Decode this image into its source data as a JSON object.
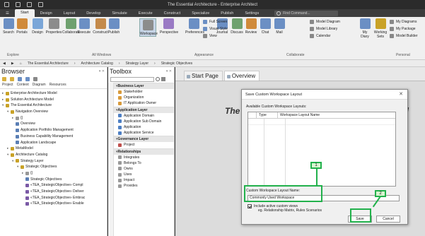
{
  "window": {
    "title": "The Essential Architecture - Enterprise Architect"
  },
  "ribbon_tabs": [
    "Start",
    "Design",
    "Layout",
    "Develop",
    "Simulate",
    "Execute",
    "Construct",
    "Specialize",
    "Publish",
    "Settings"
  ],
  "command_search": "Find Command...",
  "ribbon": {
    "buttons": [
      {
        "label": "Search",
        "icon": "search-icon"
      },
      {
        "label": "Portals",
        "icon": "portals-icon"
      },
      {
        "label": "Design",
        "icon": "design-icon"
      },
      {
        "label": "Properties",
        "icon": "properties-icon"
      },
      {
        "label": "Collaborate",
        "icon": "collaborate-icon"
      },
      {
        "label": "Execute",
        "icon": "execute-icon"
      },
      {
        "label": "Construct",
        "icon": "construct-icon"
      },
      {
        "label": "Publish",
        "icon": "publish-icon"
      },
      {
        "label": "Workspace",
        "icon": "workspace-icon"
      },
      {
        "label": "Perspective",
        "icon": "perspective-icon"
      },
      {
        "label": "Preferences",
        "icon": "preferences-icon"
      },
      {
        "label": "Journal",
        "icon": "journal-icon"
      },
      {
        "label": "Discuss",
        "icon": "discuss-icon"
      },
      {
        "label": "Review",
        "icon": "review-icon"
      },
      {
        "label": "Chat",
        "icon": "chat-icon"
      },
      {
        "label": "Mail",
        "icon": "mail-icon"
      },
      {
        "label": "My Diary",
        "icon": "diary-icon"
      },
      {
        "label": "Working Sets",
        "icon": "working-sets-icon"
      }
    ],
    "small": {
      "full_screen": "Full Screen",
      "visual_style": "Visual Style",
      "view": "View",
      "model_diagram": "Model Diagram",
      "model_library": "Model Library",
      "calendar": "Calendar",
      "my_diagrams": "My Diagrams",
      "my_package": "My Package",
      "model_builder": "Model Builder"
    },
    "groups": {
      "explore": "Explore",
      "all_windows": "All Windows",
      "appearance": "Appearance",
      "collaborate": "Collaborate",
      "personal": "Personal"
    }
  },
  "breadcrumb": [
    "The Essential Architecture",
    "Architecture Catalog",
    "Strategy Layer",
    "Strategic Objectives"
  ],
  "browser": {
    "title": "Browser",
    "tabs": [
      "Project",
      "Context",
      "Diagram",
      "Resources"
    ],
    "items": [
      {
        "label": "Enterprise Architecture Model",
        "exp": "▸",
        "indent": 0,
        "color": "#c9a227"
      },
      {
        "label": "Solution Architecture Model",
        "exp": "▸",
        "indent": 0,
        "color": "#c9a227"
      },
      {
        "label": "The Essential Architecture",
        "exp": "▾",
        "indent": 0,
        "color": "#c9a227"
      },
      {
        "label": "Navigation Overview",
        "exp": "▾",
        "indent": 1,
        "color": "#c9a227"
      },
      {
        "label": "{}",
        "exp": "▸",
        "indent": 2,
        "color": "#999"
      },
      {
        "label": "Overview",
        "exp": "",
        "indent": 2,
        "color": "#5b7fb5"
      },
      {
        "label": "Application Portfolio Management",
        "exp": "",
        "indent": 2,
        "color": "#5b7fb5"
      },
      {
        "label": "Business Capability Management",
        "exp": "",
        "indent": 2,
        "color": "#5b7fb5"
      },
      {
        "label": "Application Landscape",
        "exp": "",
        "indent": 2,
        "color": "#5b7fb5"
      },
      {
        "label": "MetaModel",
        "exp": "▸",
        "indent": 1,
        "color": "#c9a227"
      },
      {
        "label": "Architecture Catalog",
        "exp": "▾",
        "indent": 1,
        "color": "#c9a227"
      },
      {
        "label": "Strategy Layer",
        "exp": "▾",
        "indent": 2,
        "color": "#c9a227"
      },
      {
        "label": "Strategic Objectives",
        "exp": "▾",
        "indent": 3,
        "color": "#c9a227"
      },
      {
        "label": "{}",
        "exp": "▸",
        "indent": 4,
        "color": "#999"
      },
      {
        "label": "Strategic Objectives",
        "exp": "",
        "indent": 4,
        "color": "#5b7fb5"
      },
      {
        "label": "«TEA_StrategicObjective» Compl",
        "exp": "",
        "indent": 4,
        "color": "#7b5aa6"
      },
      {
        "label": "«TEA_StrategicObjective» Deliver",
        "exp": "",
        "indent": 4,
        "color": "#7b5aa6"
      },
      {
        "label": "«TEA_StrategicObjective» Embrac",
        "exp": "",
        "indent": 4,
        "color": "#7b5aa6"
      },
      {
        "label": "«TEA_StrategicObjective» Enable",
        "exp": "",
        "indent": 4,
        "color": "#7b5aa6"
      }
    ]
  },
  "toolbox": {
    "title": "Toolbox",
    "groups": [
      {
        "name": "Business Layer",
        "items": [
          {
            "label": "Stakeholder",
            "color": "#d89a3a"
          },
          {
            "label": "Organization",
            "color": "#d89a3a"
          },
          {
            "label": "IT Application Owner",
            "color": "#d89a3a"
          }
        ]
      },
      {
        "name": "Application Layer",
        "items": [
          {
            "label": "Application Domain",
            "color": "#4d7fc4"
          },
          {
            "label": "Application Sub Domain",
            "color": "#4d7fc4"
          },
          {
            "label": "Application",
            "color": "#4d7fc4"
          },
          {
            "label": "Application Service",
            "color": "#4d7fc4"
          }
        ]
      },
      {
        "name": "Governance Layer",
        "items": [
          {
            "label": "Project",
            "color": "#c0504d"
          }
        ]
      },
      {
        "name": "Relationships",
        "items": [
          {
            "label": "Integrates",
            "color": "#999"
          },
          {
            "label": "Belongs To",
            "color": "#999"
          },
          {
            "label": "Owns",
            "color": "#999"
          },
          {
            "label": "Uses",
            "color": "#999"
          },
          {
            "label": "Impact",
            "color": "#999"
          },
          {
            "label": "Provides",
            "color": "#999"
          }
        ]
      }
    ]
  },
  "doc_tabs": [
    "Start Page",
    "Overview"
  ],
  "watermark": {
    "left": "The",
    "right": "el"
  },
  "dialog": {
    "title": "Save Custom Workspace Layout",
    "available_label": "Available Custom Workspace Layouts:",
    "col_type": "Type",
    "col_name": "Workspace Layout Name",
    "name_label": "Custom Workspace Layout Name:",
    "name_value": "Commonly Used Workspace",
    "include_label": "Include active custom views",
    "include_hint": "eg. Relationship Matrix, Rules Scenarios",
    "save": "Save",
    "cancel": "Cancel"
  },
  "callouts": [
    "1",
    "2"
  ],
  "colors": {
    "highlight": "#22b14c",
    "workspace_btn": "#c6d4e6"
  }
}
